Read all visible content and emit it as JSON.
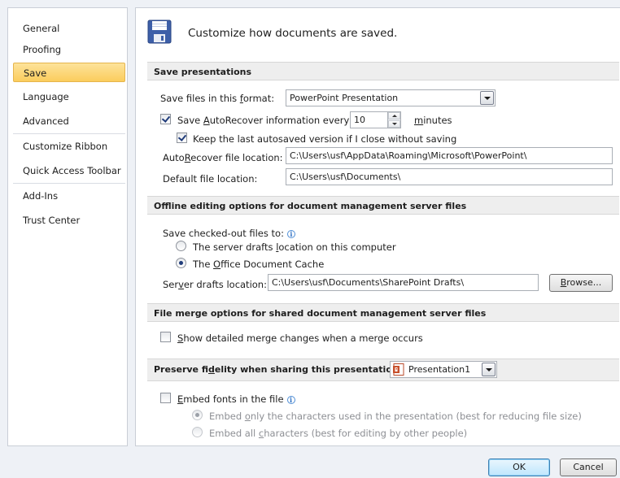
{
  "sidebar": {
    "items": [
      {
        "label": "General"
      },
      {
        "label": "Proofing"
      },
      {
        "label": "Save"
      },
      {
        "label": "Language"
      },
      {
        "label": "Advanced"
      },
      {
        "label": "Customize Ribbon"
      },
      {
        "label": "Quick Access Toolbar"
      },
      {
        "label": "Add-Ins"
      },
      {
        "label": "Trust Center"
      }
    ],
    "selected": "Save"
  },
  "header": {
    "icon": "floppy-disk-icon",
    "text": "Customize how documents are saved."
  },
  "save_presentations": {
    "title": "Save presentations",
    "format_label_pre": "Save files in this ",
    "format_label_u": "f",
    "format_label_post": "ormat:",
    "format_value": "PowerPoint Presentation",
    "autorecover_pre": "Save ",
    "autorecover_u": "A",
    "autorecover_post": "utoRecover information every",
    "autorecover_checked": true,
    "autorecover_minutes": "10",
    "minutes_u": "m",
    "minutes_post": "inutes",
    "keep_last_label": "Keep the last autosaved version if I close without saving",
    "keep_last_checked": true,
    "autorecover_loc_pre": "Auto",
    "autorecover_loc_u": "R",
    "autorecover_loc_post": "ecover file location:",
    "autorecover_loc_value": "C:\\Users\\usf\\AppData\\Roaming\\Microsoft\\PowerPoint\\",
    "default_loc_pre": "Default f",
    "default_loc_u": "i",
    "default_loc_post": "le location:",
    "default_loc_value": "C:\\Users\\usf\\Documents\\"
  },
  "offline_editing": {
    "title": "Offline editing options for document management server files",
    "checked_out_label": "Save checked-out files to:",
    "radio_server_pre": "The server drafts ",
    "radio_server_u": "l",
    "radio_server_post": "ocation on this computer",
    "radio_cache_pre": "The ",
    "radio_cache_u": "O",
    "radio_cache_post": "ffice Document Cache",
    "selected_radio": "office-document-cache",
    "drafts_loc_pre": "Ser",
    "drafts_loc_u": "v",
    "drafts_loc_post": "er drafts location:",
    "drafts_loc_value": "C:\\Users\\usf\\Documents\\SharePoint Drafts\\",
    "browse_pre": "",
    "browse_u": "B",
    "browse_post": "rowse..."
  },
  "file_merge": {
    "title": "File merge options for shared document management server files",
    "show_merge_u": "S",
    "show_merge_post": "how detailed merge changes when a merge occurs",
    "show_merge_checked": false
  },
  "preserve_fidelity": {
    "title_pre": "Preserve fi",
    "title_u": "d",
    "title_post": "elity when sharing this presentation:",
    "presentation_value": "Presentation1",
    "presentation_icon": "powerpoint-file-icon",
    "embed_u": "E",
    "embed_post": "mbed fonts in the file",
    "embed_checked": false,
    "embed_only_pre": "Embed ",
    "embed_only_u": "o",
    "embed_only_post": "nly the characters used in the presentation (best for reducing file size)",
    "embed_all_pre": "Embed all ",
    "embed_all_u": "c",
    "embed_all_post": "haracters (best for editing by other people)"
  },
  "footer": {
    "ok_label": "OK",
    "cancel_label": "Cancel"
  }
}
